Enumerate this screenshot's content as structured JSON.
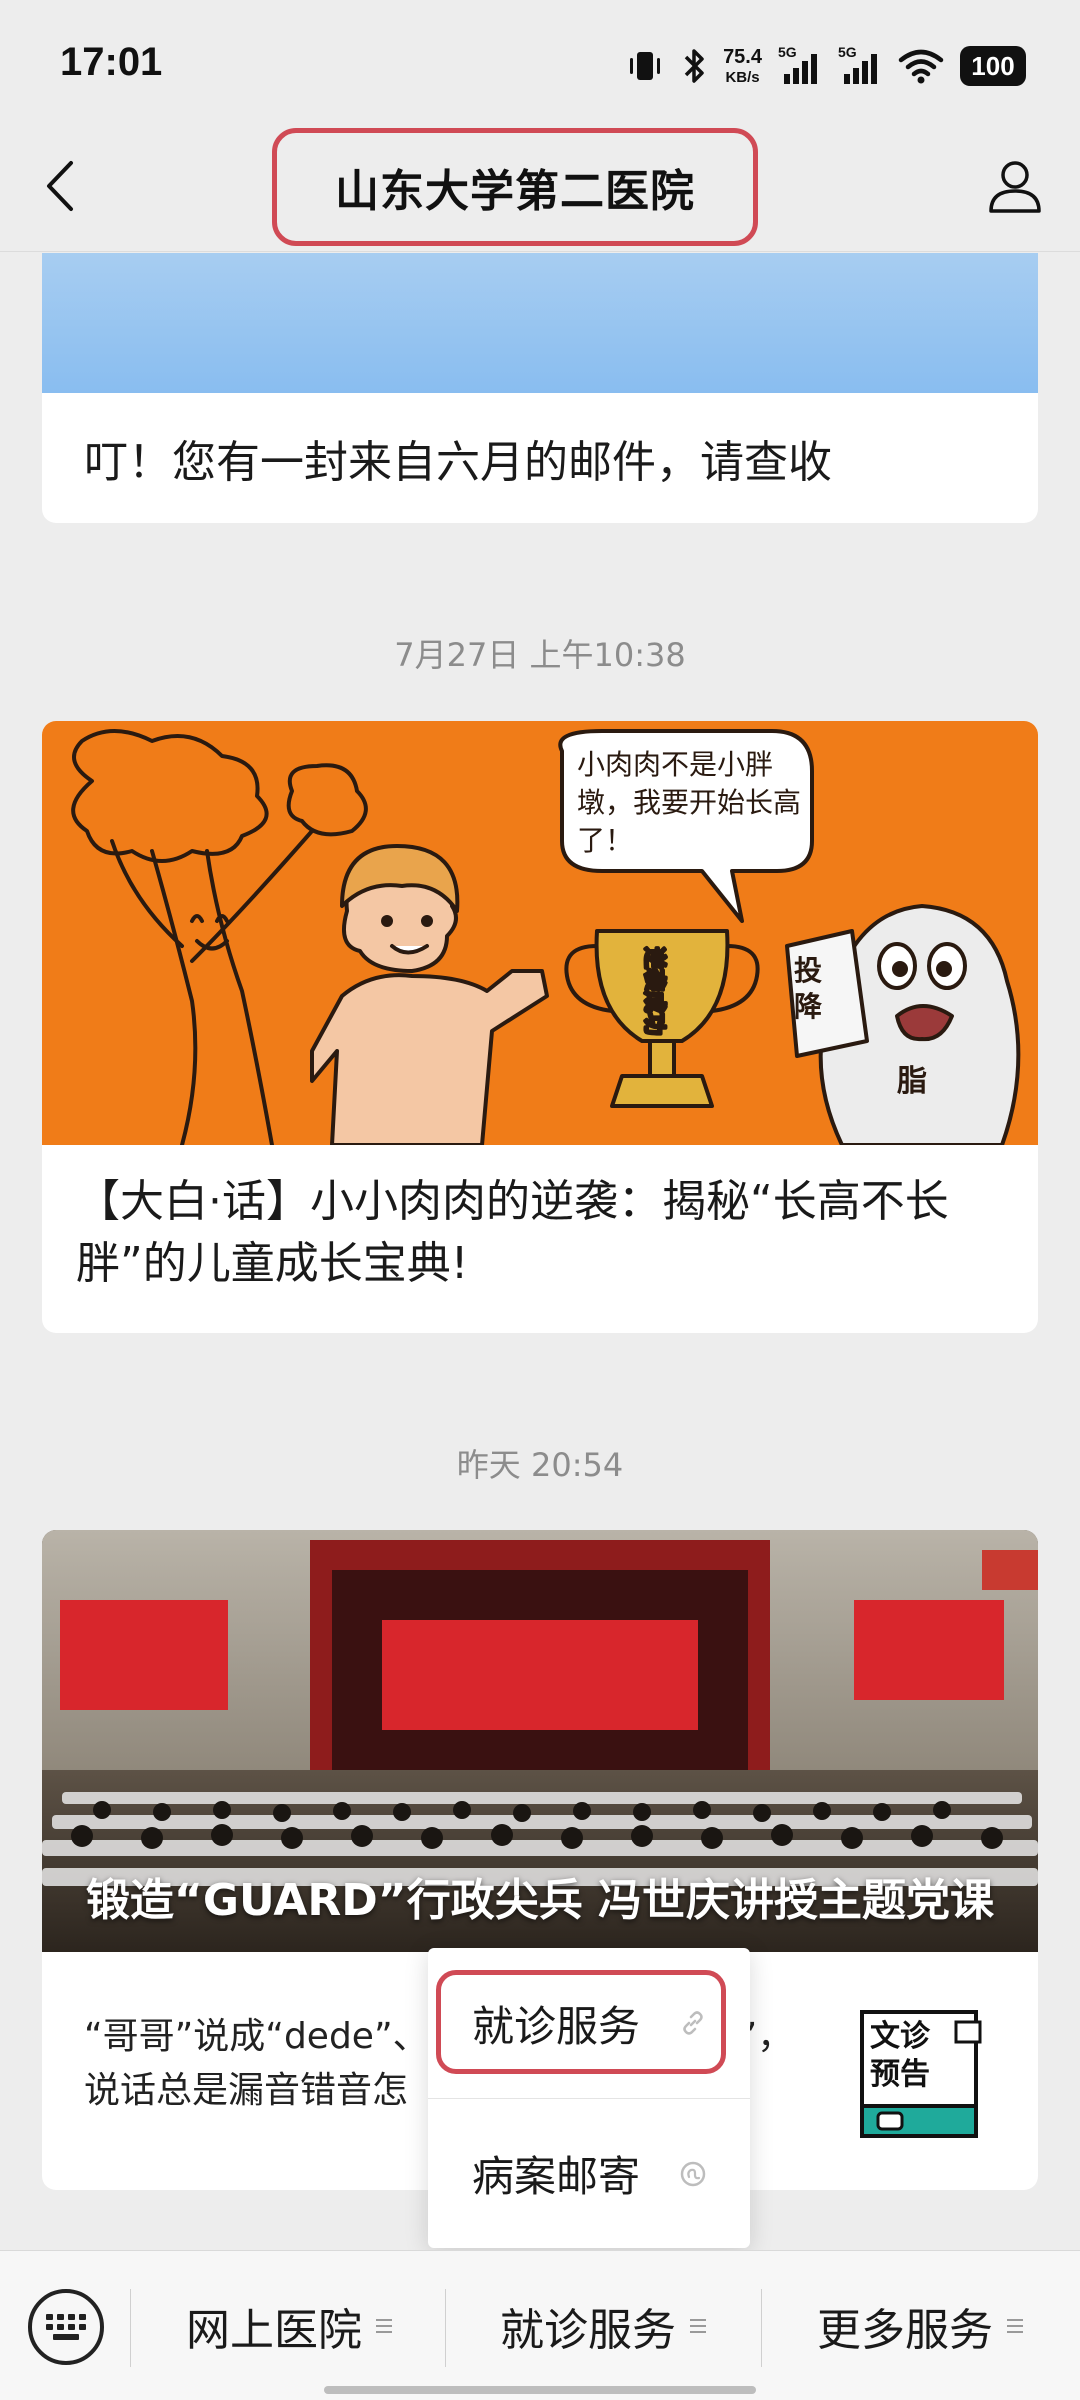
{
  "status_bar": {
    "time": "17:01",
    "speed_value": "75.4",
    "speed_unit": "KB/s",
    "signal_1_label": "5G",
    "signal_2_label": "5G",
    "battery": "100",
    "icons": [
      "vibrate-icon",
      "bluetooth-icon",
      "signal-icon",
      "wifi-icon",
      "battery-icon"
    ]
  },
  "header": {
    "title": "山东大学第二医院",
    "back_icon": "back-chevron-icon",
    "profile_icon": "person-icon"
  },
  "feed": {
    "card_1": {
      "caption": "叮！您有一封来自六月的邮件，请查收"
    },
    "timestamp_1": "7月27日 上午10:38",
    "card_2": {
      "bubble_text": "小肉肉不是小胖墩，我要开始长高了！",
      "trophy_text": "逆袭成功",
      "sign_text": "投降",
      "monster_text": "脂",
      "caption": "【大白·话】小小肉肉的逆袭：揭秘“长高不长胖”的儿童成长宝典!"
    },
    "timestamp_2": "昨天 20:54",
    "card_3": {
      "photo_title": "锻造“GUARD”行政尖兵 冯世庆讲授主题党课",
      "summary_line_1": "“哥哥”说成“dede”、",
      "summary_line_1_tail": "l”，",
      "summary_line_2": "说话总是漏音错音怎",
      "thumb_line_1": "文诊",
      "thumb_line_2": "预告"
    }
  },
  "popup": {
    "items": [
      {
        "label": "就诊服务"
      },
      {
        "label": "病案邮寄"
      }
    ]
  },
  "bottom_menu": {
    "items": [
      {
        "label": "网上医院"
      },
      {
        "label": "就诊服务"
      },
      {
        "label": "更多服务"
      }
    ]
  },
  "colors": {
    "background": "#ededed",
    "highlight_border": "#d04a55",
    "orange_banner": "#f07c18",
    "sky": "#89bdf0"
  }
}
